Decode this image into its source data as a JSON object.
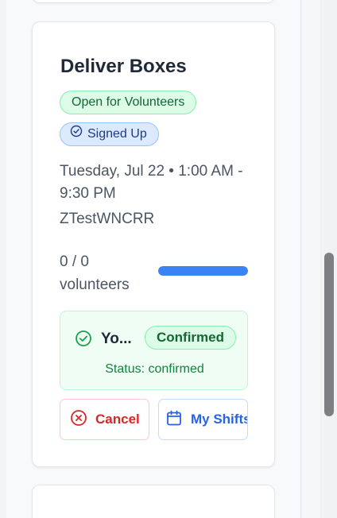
{
  "event": {
    "title": "Deliver Boxes",
    "badge_open": "Open for Volunteers",
    "badge_signed": "Signed Up",
    "datetime": "Tuesday, Jul 22 • 1:00 AM - 9:30 PM",
    "location": "ZTestWNCRR",
    "volunteers": "0 / 0 volunteers",
    "progress_fraction": 1.0
  },
  "status": {
    "you_label": "Yo...",
    "confirmed_badge": "Confirmed",
    "status_text": "Status: confirmed"
  },
  "actions": {
    "cancel_label": "Cancel",
    "my_shifts_label": "My Shifts"
  },
  "colors": {
    "accent_blue": "#3b82f6",
    "green": "#16a34a",
    "red": "#dc2626"
  },
  "icons": {
    "signed": "check-circle-icon",
    "status": "check-circle-icon",
    "cancel": "x-circle-icon",
    "my_shifts": "calendar-icon"
  }
}
